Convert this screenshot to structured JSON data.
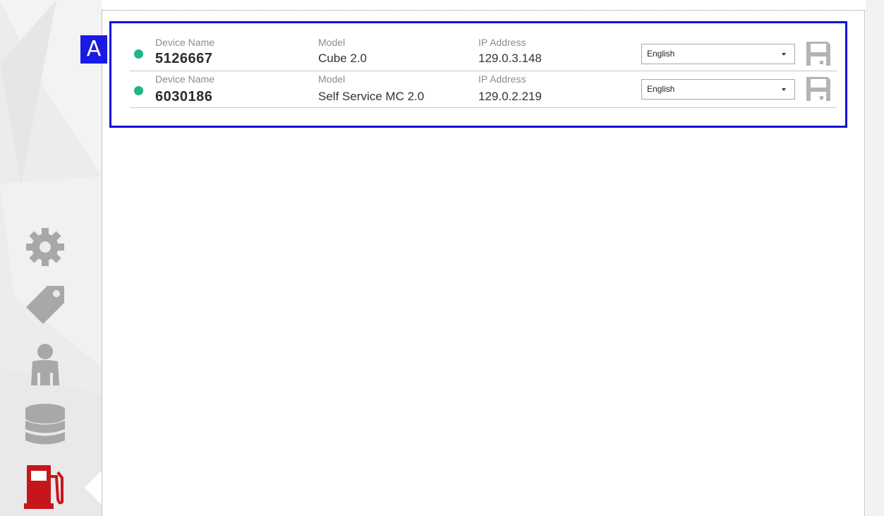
{
  "annotation": {
    "badge_letter": "A",
    "highlight_color": "#1010dd"
  },
  "sidebar": {
    "items": [
      {
        "name": "settings",
        "icon": "gear-icon",
        "active": false
      },
      {
        "name": "tags",
        "icon": "tag-icon",
        "active": false
      },
      {
        "name": "users",
        "icon": "person-icon",
        "active": false
      },
      {
        "name": "database",
        "icon": "database-icon",
        "active": false
      },
      {
        "name": "fuel-station",
        "icon": "fuel-pump-icon",
        "active": true
      }
    ],
    "inactive_icon_color": "#a8a8a8",
    "active_icon_color": "#c6161c"
  },
  "devices": {
    "status_color": "#22b38a",
    "rows": [
      {
        "name_label": "Device Name",
        "name": "5126667",
        "model_label": "Model",
        "model": "Cube 2.0",
        "ip_label": "IP Address",
        "ip": "129.0.3.148",
        "language": "English",
        "status": "online"
      },
      {
        "name_label": "Device Name",
        "name": "6030186",
        "model_label": "Model",
        "model": "Self Service MC 2.0",
        "ip_label": "IP Address",
        "ip": "129.0.2.219",
        "language": "English",
        "status": "online"
      }
    ]
  }
}
